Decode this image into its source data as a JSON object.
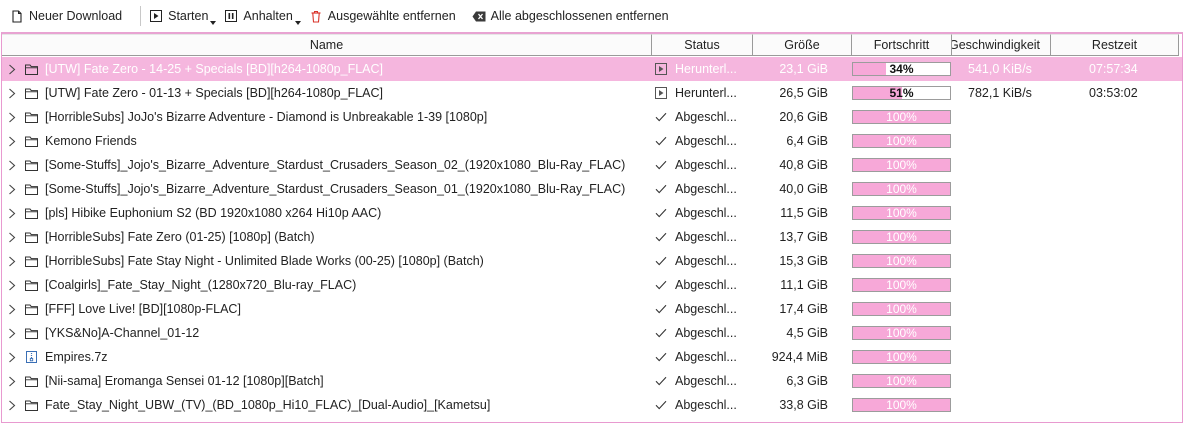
{
  "toolbar": {
    "new_download": "Neuer Download",
    "start": "Starten",
    "pause": "Anhalten",
    "remove_selected": "Ausgewählte entfernen",
    "remove_completed": "Alle abgeschlossenen entfernen"
  },
  "columns": {
    "name": "Name",
    "status": "Status",
    "size": "Größe",
    "progress": "Fortschritt",
    "speed": "Geschwindigkeit",
    "remaining": "Restzeit"
  },
  "colors": {
    "accent": "#f5b6de",
    "progress_fill": "#f7a8d8",
    "border": "#e89ad0",
    "remove_icon": "#d9342b"
  },
  "rows": [
    {
      "name": "[UTW] Fate Zero - 14-25 + Specials [BD][h264-1080p_FLAC]",
      "status": "Herunterl...",
      "status_icon": "play-icon",
      "type_icon": "folder-icon",
      "size": "23,1 GiB",
      "progress_label": "34%",
      "progress": 0.34,
      "speed": "541,0 KiB/s",
      "remaining": "07:57:34",
      "selected": true
    },
    {
      "name": "[UTW] Fate Zero - 01-13 + Specials [BD][h264-1080p_FLAC]",
      "status": "Herunterl...",
      "status_icon": "play-icon",
      "type_icon": "folder-icon",
      "size": "26,5 GiB",
      "progress_label": "51%",
      "progress": 0.51,
      "speed": "782,1 KiB/s",
      "remaining": "03:53:02",
      "selected": false
    },
    {
      "name": "[HorribleSubs] JoJo's Bizarre Adventure - Diamond is Unbreakable  1-39 [1080p]",
      "status": "Abgeschl...",
      "status_icon": "check-icon",
      "type_icon": "folder-icon",
      "size": "20,6 GiB",
      "progress_label": "100%",
      "progress": 1.0,
      "speed": "",
      "remaining": "",
      "selected": false
    },
    {
      "name": "Kemono Friends",
      "status": "Abgeschl...",
      "status_icon": "check-icon",
      "type_icon": "folder-icon",
      "size": "6,4 GiB",
      "progress_label": "100%",
      "progress": 1.0,
      "speed": "",
      "remaining": "",
      "selected": false
    },
    {
      "name": "[Some-Stuffs]_Jojo's_Bizarre_Adventure_Stardust_Crusaders_Season_02_(1920x1080_Blu-Ray_FLAC)",
      "status": "Abgeschl...",
      "status_icon": "check-icon",
      "type_icon": "folder-icon",
      "size": "40,8 GiB",
      "progress_label": "100%",
      "progress": 1.0,
      "speed": "",
      "remaining": "",
      "selected": false
    },
    {
      "name": "[Some-Stuffs]_Jojo's_Bizarre_Adventure_Stardust_Crusaders_Season_01_(1920x1080_Blu-Ray_FLAC)",
      "status": "Abgeschl...",
      "status_icon": "check-icon",
      "type_icon": "folder-icon",
      "size": "40,0 GiB",
      "progress_label": "100%",
      "progress": 1.0,
      "speed": "",
      "remaining": "",
      "selected": false
    },
    {
      "name": "[pls] Hibike Euphonium S2 (BD 1920x1080 x264 Hi10p AAC)",
      "status": "Abgeschl...",
      "status_icon": "check-icon",
      "type_icon": "folder-icon",
      "size": "11,5 GiB",
      "progress_label": "100%",
      "progress": 1.0,
      "speed": "",
      "remaining": "",
      "selected": false
    },
    {
      "name": "[HorribleSubs] Fate Zero (01-25) [1080p] (Batch)",
      "status": "Abgeschl...",
      "status_icon": "check-icon",
      "type_icon": "folder-icon",
      "size": "13,7 GiB",
      "progress_label": "100%",
      "progress": 1.0,
      "speed": "",
      "remaining": "",
      "selected": false
    },
    {
      "name": "[HorribleSubs] Fate Stay Night - Unlimited Blade Works (00-25) [1080p] (Batch)",
      "status": "Abgeschl...",
      "status_icon": "check-icon",
      "type_icon": "folder-icon",
      "size": "15,3 GiB",
      "progress_label": "100%",
      "progress": 1.0,
      "speed": "",
      "remaining": "",
      "selected": false
    },
    {
      "name": "[Coalgirls]_Fate_Stay_Night_(1280x720_Blu-ray_FLAC)",
      "status": "Abgeschl...",
      "status_icon": "check-icon",
      "type_icon": "folder-icon",
      "size": "11,1 GiB",
      "progress_label": "100%",
      "progress": 1.0,
      "speed": "",
      "remaining": "",
      "selected": false
    },
    {
      "name": "[FFF] Love Live! [BD][1080p-FLAC]",
      "status": "Abgeschl...",
      "status_icon": "check-icon",
      "type_icon": "folder-icon",
      "size": "17,4 GiB",
      "progress_label": "100%",
      "progress": 1.0,
      "speed": "",
      "remaining": "",
      "selected": false
    },
    {
      "name": "[YKS&No]A-Channel_01-12",
      "status": "Abgeschl...",
      "status_icon": "check-icon",
      "type_icon": "folder-icon",
      "size": "4,5 GiB",
      "progress_label": "100%",
      "progress": 1.0,
      "speed": "",
      "remaining": "",
      "selected": false
    },
    {
      "name": "Empires.7z",
      "status": "Abgeschl...",
      "status_icon": "check-icon",
      "type_icon": "archive-file-icon",
      "size": "924,4 MiB",
      "progress_label": "100%",
      "progress": 1.0,
      "speed": "",
      "remaining": "",
      "selected": false
    },
    {
      "name": "[Nii-sama] Eromanga Sensei 01-12 [1080p][Batch]",
      "status": "Abgeschl...",
      "status_icon": "check-icon",
      "type_icon": "folder-icon",
      "size": "6,3 GiB",
      "progress_label": "100%",
      "progress": 1.0,
      "speed": "",
      "remaining": "",
      "selected": false
    },
    {
      "name": "Fate_Stay_Night_UBW_(TV)_(BD_1080p_Hi10_FLAC)_[Dual-Audio]_[Kametsu]",
      "status": "Abgeschl...",
      "status_icon": "check-icon",
      "type_icon": "folder-icon",
      "size": "33,8 GiB",
      "progress_label": "100%",
      "progress": 1.0,
      "speed": "",
      "remaining": "",
      "selected": false
    }
  ]
}
